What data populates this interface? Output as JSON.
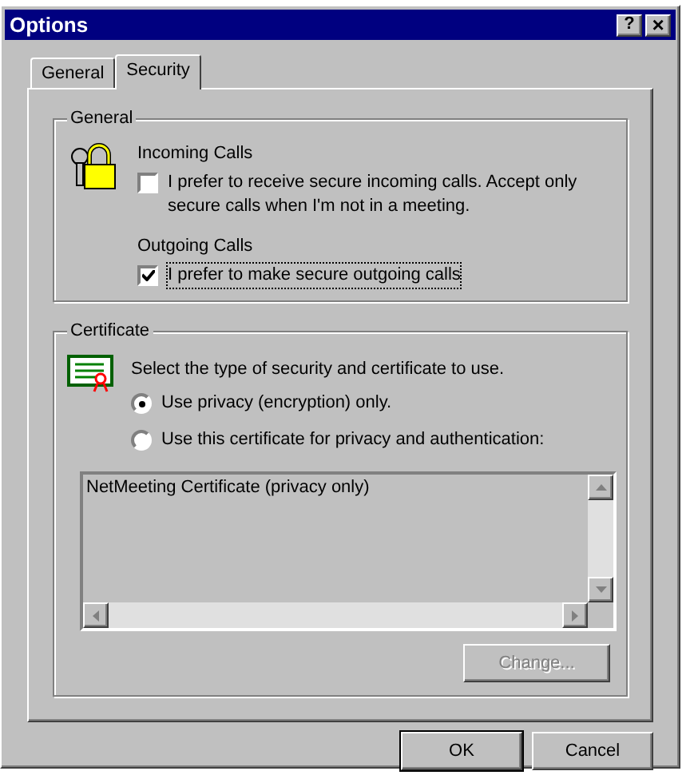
{
  "window": {
    "title": "Options",
    "help_button": "?",
    "close_button": "×"
  },
  "tabs": [
    {
      "label": "General",
      "selected": false
    },
    {
      "label": "Security",
      "selected": true
    }
  ],
  "general_group": {
    "title": "General",
    "incoming_heading": "Incoming Calls",
    "incoming_checkbox": {
      "label": "I prefer to receive secure incoming calls. Accept only secure calls when I'm not in a meeting.",
      "checked": false
    },
    "outgoing_heading": "Outgoing Calls",
    "outgoing_checkbox": {
      "label": "I prefer to make secure outgoing calls",
      "checked": true
    }
  },
  "certificate_group": {
    "title": "Certificate",
    "description": "Select the type of security and certificate to use.",
    "options": [
      {
        "label": "Use privacy (encryption) only.",
        "selected": true
      },
      {
        "label": "Use this certificate for privacy and authentication:",
        "selected": false
      }
    ],
    "list_items": [
      "NetMeeting Certificate (privacy only)"
    ],
    "change_button": {
      "label": "Change...",
      "disabled": true
    }
  },
  "buttons": [
    "OK",
    "Cancel"
  ]
}
